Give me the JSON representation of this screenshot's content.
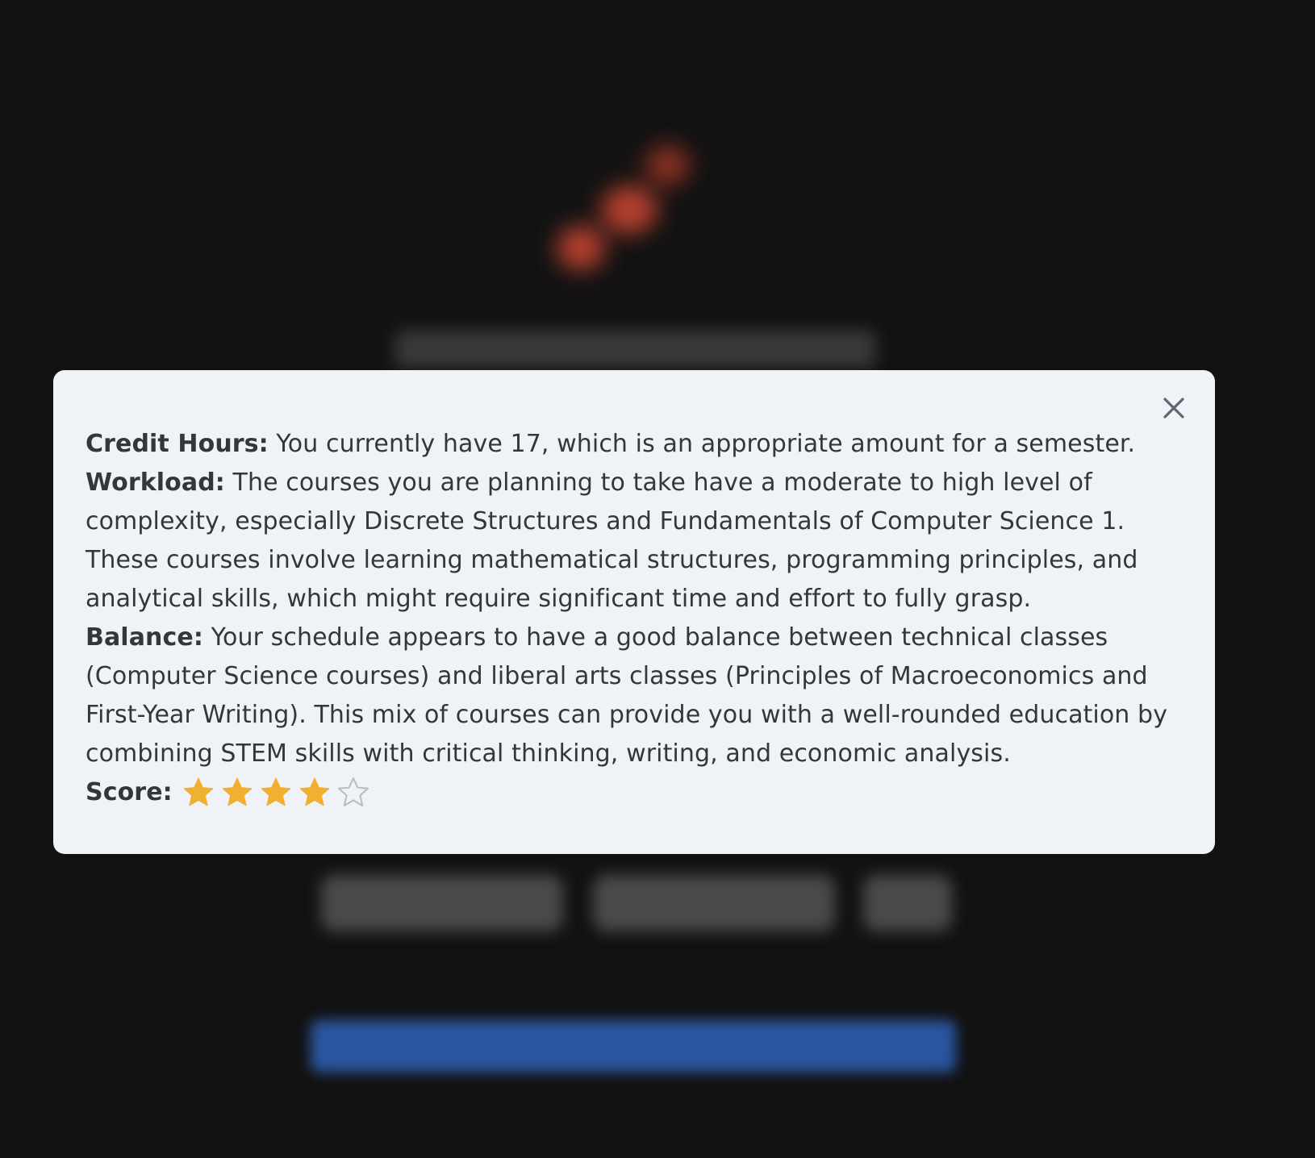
{
  "modal": {
    "close_label": "Close",
    "credit_hours": {
      "label": "Credit Hours:",
      "text": " You currently have 17, which is an appropriate amount for a semester."
    },
    "workload": {
      "label": "Workload:",
      "text": " The courses you are planning to take have a moderate to high level of complexity, especially Discrete Structures and Fundamentals of Computer Science 1. These courses involve learning mathematical structures, programming principles, and analytical skills, which might require significant time and effort to fully grasp."
    },
    "balance": {
      "label": "Balance:",
      "text": " Your schedule appears to have a good balance between technical classes (Computer Science courses) and liberal arts classes (Principles of Macroeconomics and First-Year Writing). This mix of courses can provide you with a well-rounded education by combining STEM skills with critical thinking, writing, and economic analysis."
    },
    "score": {
      "label": "Score:",
      "value": 4,
      "max": 5
    }
  },
  "colors": {
    "modal_background": "#eff3f8",
    "text": "#33363b",
    "star_filled": "#f0b030",
    "star_empty_outline": "#b8bcc2",
    "page_background": "#121212",
    "cta_blue": "#2a56a0"
  },
  "icons": {
    "close": "close-icon",
    "star_filled": "star-filled-icon",
    "star_empty": "star-outline-icon"
  }
}
